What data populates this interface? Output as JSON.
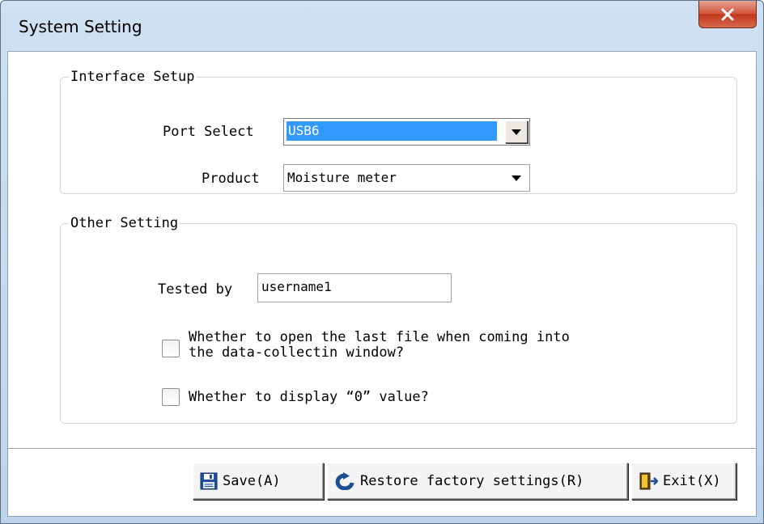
{
  "window": {
    "title": "System Setting",
    "close_icon": "close-x-icon",
    "accent_color": "#3399ff",
    "close_color": "#c0381c"
  },
  "interface_setup": {
    "legend": "Interface Setup",
    "port_label": "Port Select",
    "port_value": "USB6",
    "product_label": "Product",
    "product_value": "Moisture meter"
  },
  "other_setting": {
    "legend": "Other Setting",
    "tested_by_label": "Tested by",
    "tested_by_value": "username1",
    "open_last_file_line1": "Whether to open the last file when coming into",
    "open_last_file_line2": "the data-collectin window?",
    "open_last_file_checked": false,
    "display_zero_label": "Whether to display “0” value?",
    "display_zero_checked": false
  },
  "buttons": {
    "save_label": "Save(A)",
    "save_icon": "floppy-disk-icon",
    "restore_label": "Restore factory settings(R)",
    "restore_icon": "restore-arrow-icon",
    "exit_label": "Exit(X)",
    "exit_icon": "exit-door-icon"
  }
}
